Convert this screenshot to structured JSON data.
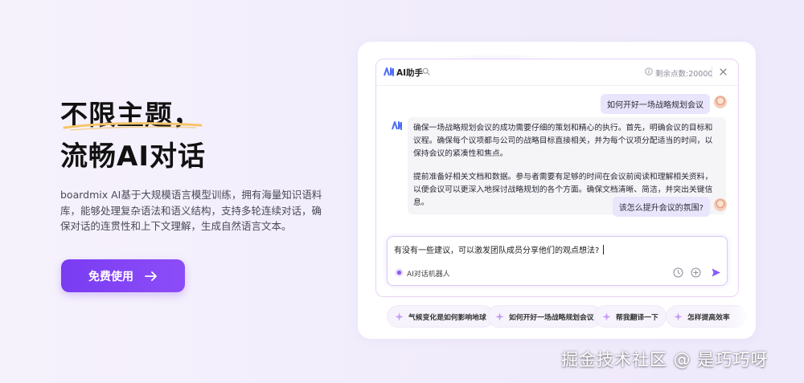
{
  "hero": {
    "title_line1": "不限主题，",
    "title_line2": "流畅AI对话",
    "description": "boardmix AI基于大规模语言模型训练，拥有海量知识语料库，能够处理复杂语法和语义结构，支持多轮连续对话，确保对话的连贯性和上下文理解，生成自然语言文本。",
    "cta_label": "免费使用",
    "accent_color": "#7b3ff2",
    "underline_color": "#f5c56c"
  },
  "assistant": {
    "title": "AI助手",
    "points_label": "剩余点数:20000",
    "icons": [
      "ai-brand-icon",
      "search-icon",
      "info-icon",
      "close-icon",
      "clock-icon",
      "plus-circle-icon",
      "send-icon",
      "robot-icon",
      "sparkle-icon"
    ],
    "messages": [
      {
        "role": "user",
        "text": "如何开好一场战略规划会议"
      },
      {
        "role": "assistant",
        "paragraphs": [
          "确保一场战略规划会议的成功需要仔细的策划和精心的执行。首先，明确会议的目标和议程。确保每个议项都与公司的战略目标直接相关，并为每个议项分配适当的时间，以保持会议的紧凑性和焦点。",
          "提前准备好相关文档和数据。参与者需要有足够的时间在会议前阅读和理解相关资料，以便会议可以更深入地探讨战略规划的各个方面。确保文档清晰、简洁，并突出关键信息。"
        ]
      },
      {
        "role": "user",
        "text": "该怎么提升会议的氛围?"
      }
    ],
    "input_value": "有没有一些建议，可以激发团队成员分享他们的观点想法?",
    "robot_label": "AI对话机器人",
    "suggestions": [
      "气候变化是如何影响地球",
      "如何开好一场战略规划会议",
      "帮我翻译一下",
      "怎样提高效率"
    ]
  },
  "watermark": "掘金技术社区 @ 是巧巧呀"
}
